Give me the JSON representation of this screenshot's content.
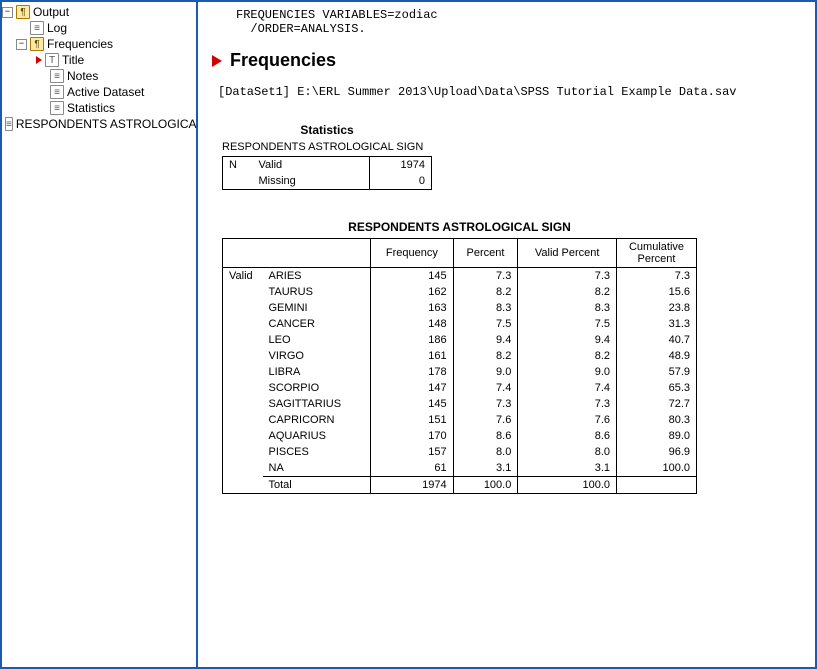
{
  "tree": {
    "root": "Output",
    "log": "Log",
    "frequencies": "Frequencies",
    "title": "Title",
    "notes": "Notes",
    "active_dataset": "Active Dataset",
    "statistics": "Statistics",
    "respondents": "RESPONDENTS ASTROLOGICAL SIGN"
  },
  "syntax_line1": "FREQUENCIES VARIABLES=zodiac",
  "syntax_line2": "  /ORDER=ANALYSIS.",
  "heading": "Frequencies",
  "dataset_line": "[DataSet1] E:\\ERL Summer 2013\\Upload\\Data\\SPSS Tutorial Example Data.sav",
  "stats": {
    "title": "Statistics",
    "subtitle": "RESPONDENTS ASTROLOGICAL SIGN",
    "n_label": "N",
    "valid_label": "Valid",
    "valid_value": "1974",
    "missing_label": "Missing",
    "missing_value": "0"
  },
  "freq": {
    "title": "RESPONDENTS ASTROLOGICAL SIGN",
    "col_blank": "",
    "col_frequency": "Frequency",
    "col_percent": "Percent",
    "col_valid_percent": "Valid Percent",
    "col_cumulative_percent": "Cumulative Percent",
    "group_label": "Valid",
    "rows": [
      {
        "label": "ARIES",
        "freq": "145",
        "pct": "7.3",
        "vpct": "7.3",
        "cpct": "7.3"
      },
      {
        "label": "TAURUS",
        "freq": "162",
        "pct": "8.2",
        "vpct": "8.2",
        "cpct": "15.6"
      },
      {
        "label": "GEMINI",
        "freq": "163",
        "pct": "8.3",
        "vpct": "8.3",
        "cpct": "23.8"
      },
      {
        "label": "CANCER",
        "freq": "148",
        "pct": "7.5",
        "vpct": "7.5",
        "cpct": "31.3"
      },
      {
        "label": "LEO",
        "freq": "186",
        "pct": "9.4",
        "vpct": "9.4",
        "cpct": "40.7"
      },
      {
        "label": "VIRGO",
        "freq": "161",
        "pct": "8.2",
        "vpct": "8.2",
        "cpct": "48.9"
      },
      {
        "label": "LIBRA",
        "freq": "178",
        "pct": "9.0",
        "vpct": "9.0",
        "cpct": "57.9"
      },
      {
        "label": "SCORPIO",
        "freq": "147",
        "pct": "7.4",
        "vpct": "7.4",
        "cpct": "65.3"
      },
      {
        "label": "SAGITTARIUS",
        "freq": "145",
        "pct": "7.3",
        "vpct": "7.3",
        "cpct": "72.7"
      },
      {
        "label": "CAPRICORN",
        "freq": "151",
        "pct": "7.6",
        "vpct": "7.6",
        "cpct": "80.3"
      },
      {
        "label": "AQUARIUS",
        "freq": "170",
        "pct": "8.6",
        "vpct": "8.6",
        "cpct": "89.0"
      },
      {
        "label": "PISCES",
        "freq": "157",
        "pct": "8.0",
        "vpct": "8.0",
        "cpct": "96.9"
      },
      {
        "label": "NA",
        "freq": "61",
        "pct": "3.1",
        "vpct": "3.1",
        "cpct": "100.0"
      }
    ],
    "total": {
      "label": "Total",
      "freq": "1974",
      "pct": "100.0",
      "vpct": "100.0",
      "cpct": ""
    }
  },
  "chart_data": {
    "type": "table",
    "title": "RESPONDENTS ASTROLOGICAL SIGN",
    "categories": [
      "ARIES",
      "TAURUS",
      "GEMINI",
      "CANCER",
      "LEO",
      "VIRGO",
      "LIBRA",
      "SCORPIO",
      "SAGITTARIUS",
      "CAPRICORN",
      "AQUARIUS",
      "PISCES",
      "NA"
    ],
    "series": [
      {
        "name": "Frequency",
        "values": [
          145,
          162,
          163,
          148,
          186,
          161,
          178,
          147,
          145,
          151,
          170,
          157,
          61
        ]
      },
      {
        "name": "Percent",
        "values": [
          7.3,
          8.2,
          8.3,
          7.5,
          9.4,
          8.2,
          9.0,
          7.4,
          7.3,
          7.6,
          8.6,
          8.0,
          3.1
        ]
      },
      {
        "name": "Valid Percent",
        "values": [
          7.3,
          8.2,
          8.3,
          7.5,
          9.4,
          8.2,
          9.0,
          7.4,
          7.3,
          7.6,
          8.6,
          8.0,
          3.1
        ]
      },
      {
        "name": "Cumulative Percent",
        "values": [
          7.3,
          15.6,
          23.8,
          31.3,
          40.7,
          48.9,
          57.9,
          65.3,
          72.7,
          80.3,
          89.0,
          96.9,
          100.0
        ]
      }
    ],
    "total": {
      "Frequency": 1974,
      "Percent": 100.0,
      "Valid Percent": 100.0
    },
    "n_valid": 1974,
    "n_missing": 0
  }
}
